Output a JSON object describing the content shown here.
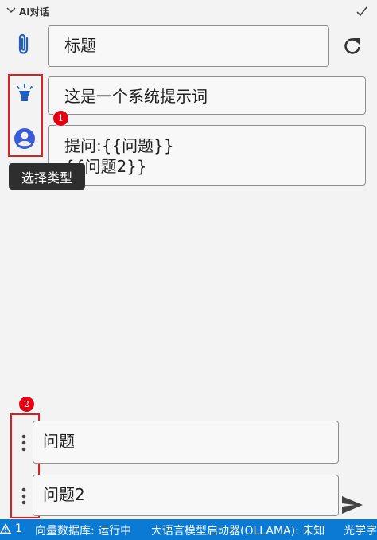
{
  "header": {
    "title": "AI对话"
  },
  "prompt": {
    "title_placeholder": "标题",
    "system_prompt": "这是一个系统提示词",
    "user_prompt": "提问:{{问题}}\n{{问题2}}"
  },
  "tooltip": {
    "text": "选择类型"
  },
  "annotations": {
    "marker_1": "1",
    "marker_2": "2"
  },
  "variables": [
    {
      "name": "问题"
    },
    {
      "name": "问题2"
    }
  ],
  "status_bar": {
    "warnings": "1",
    "vector_db": "向量数据库: 运行中",
    "llm_launcher": "大语言模型启动器(OLLAMA): 未知",
    "optical": "光学字"
  },
  "colors": {
    "accent": "#0a7ad4",
    "icon_blue": "#1f5fbf",
    "highlight": "#e01e1e",
    "marker": "#e60012"
  }
}
